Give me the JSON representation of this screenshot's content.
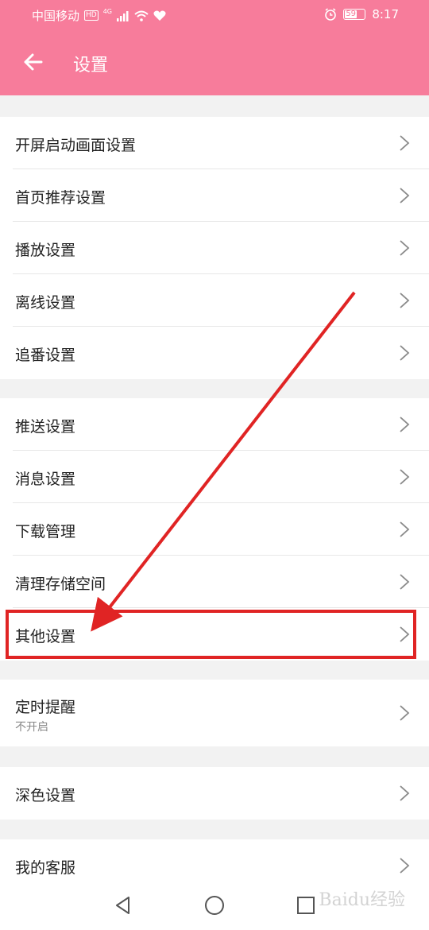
{
  "status_bar": {
    "carrier": "中国移动",
    "hd_badge": "HD",
    "network": "4G",
    "battery": "59",
    "time": "8:17"
  },
  "header": {
    "title": "设置",
    "background": "#f77c9b"
  },
  "groups": [
    {
      "items": [
        {
          "label": "开屏启动画面设置"
        },
        {
          "label": "首页推荐设置"
        },
        {
          "label": "播放设置"
        },
        {
          "label": "离线设置"
        },
        {
          "label": "追番设置"
        }
      ]
    },
    {
      "items": [
        {
          "label": "推送设置"
        },
        {
          "label": "消息设置"
        },
        {
          "label": "下载管理"
        },
        {
          "label": "清理存储空间"
        },
        {
          "label": "其他设置"
        }
      ]
    },
    {
      "items": [
        {
          "label": "定时提醒",
          "sub": "不开启"
        }
      ]
    },
    {
      "items": [
        {
          "label": "深色设置"
        }
      ]
    },
    {
      "items": [
        {
          "label": "我的客服"
        }
      ]
    }
  ],
  "annotation": {
    "highlight_color": "#e02424",
    "highlighted_item": "其他设置"
  },
  "icons": {
    "back": "arrow-left-icon",
    "chevron": "chevron-right-icon",
    "nav_back": "triangle-back-icon",
    "nav_home": "circle-home-icon",
    "nav_recent": "square-recent-icon"
  },
  "watermark": "Baidu经验"
}
